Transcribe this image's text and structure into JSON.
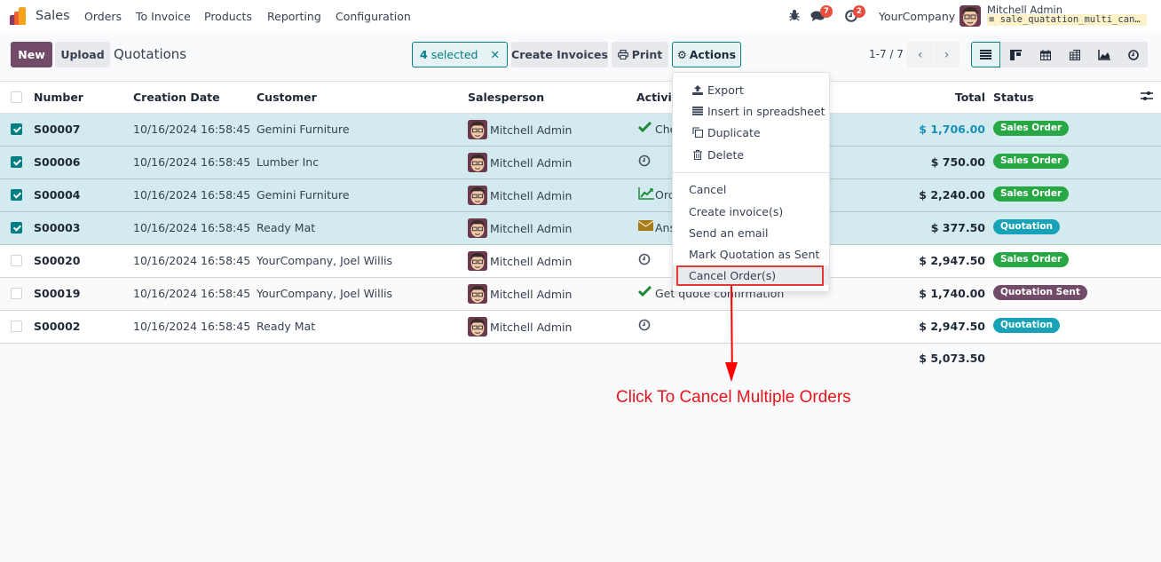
{
  "navbar": {
    "app_name": "Sales",
    "menu": [
      "Orders",
      "To Invoice",
      "Products",
      "Reporting",
      "Configuration"
    ],
    "icons": [
      "bug-icon",
      "chat-icon",
      "activity-clock-icon"
    ],
    "chat_count": "7",
    "activity_count": "2",
    "company": "YourCompany",
    "user_name": "Mitchell Admin",
    "database": "sale_quatation_multi_can…"
  },
  "control_panel": {
    "new_label": "New",
    "upload_label": "Upload",
    "title": "Quotations",
    "selected_count": "4",
    "selected_label": "selected",
    "create_invoices_label": "Create Invoices",
    "print_label": "Print",
    "actions_label": "Actions",
    "pager": "1-7 / 7",
    "views": [
      "list",
      "kanban",
      "calendar",
      "pivot",
      "graph",
      "activity"
    ]
  },
  "table": {
    "columns": [
      "Number",
      "Creation Date",
      "Customer",
      "Salesperson",
      "Activities",
      "Total",
      "Status"
    ],
    "rows": [
      {
        "selected": true,
        "number": "S00007",
        "date": "10/16/2024 16:58:45",
        "customer": "Gemini Furniture",
        "salesperson": "Mitchell Admin",
        "activity_icon": "check",
        "activity": "Che",
        "total": "$ 1,706.00",
        "status": "Sales Order",
        "status_color": "#28a745"
      },
      {
        "selected": true,
        "number": "S00006",
        "date": "10/16/2024 16:58:45",
        "customer": "Lumber Inc",
        "salesperson": "Mitchell Admin",
        "activity_icon": "clock",
        "activity": "",
        "total": "$ 750.00",
        "status": "Sales Order",
        "status_color": "#28a745"
      },
      {
        "selected": true,
        "number": "S00004",
        "date": "10/16/2024 16:58:45",
        "customer": "Gemini Furniture",
        "salesperson": "Mitchell Admin",
        "activity_icon": "chart",
        "activity": "Orc",
        "total": "$ 2,240.00",
        "status": "Sales Order",
        "status_color": "#28a745"
      },
      {
        "selected": true,
        "number": "S00003",
        "date": "10/16/2024 16:58:45",
        "customer": "Ready Mat",
        "salesperson": "Mitchell Admin",
        "activity_icon": "envelope",
        "activity": "Ans",
        "total": "$ 377.50",
        "status": "Quotation",
        "status_color": "#17a2b8"
      },
      {
        "selected": false,
        "number": "S00020",
        "date": "10/16/2024 16:58:45",
        "customer": "YourCompany, Joel Willis",
        "salesperson": "Mitchell Admin",
        "activity_icon": "clock",
        "activity": "",
        "total": "$ 2,947.50",
        "status": "Sales Order",
        "status_color": "#28a745"
      },
      {
        "selected": false,
        "number": "S00019",
        "date": "10/16/2024 16:58:45",
        "customer": "YourCompany, Joel Willis",
        "salesperson": "Mitchell Admin",
        "activity_icon": "check",
        "activity": "Get quote confirmation",
        "total": "$ 1,740.00",
        "status": "Quotation Sent",
        "status_color": "#714b67"
      },
      {
        "selected": false,
        "number": "S00002",
        "date": "10/16/2024 16:58:45",
        "customer": "Ready Mat",
        "salesperson": "Mitchell Admin",
        "activity_icon": "clock",
        "activity": "",
        "total": "$ 2,947.50",
        "status": "Quotation",
        "status_color": "#17a2b8"
      }
    ],
    "sum_total": "$ 5,073.50"
  },
  "actions_menu": {
    "section1": [
      {
        "icon": "upload-icon",
        "label": "Export"
      },
      {
        "icon": "spreadsheet-icon",
        "label": "Insert in spreadsheet"
      },
      {
        "icon": "duplicate-icon",
        "label": "Duplicate"
      },
      {
        "icon": "trash-icon",
        "label": "Delete"
      }
    ],
    "section2": [
      "Cancel",
      "Create invoice(s)",
      "Send an email",
      "Mark Quotation as Sent",
      "Cancel Order(s)"
    ]
  },
  "annotation": {
    "text": "Click To Cancel Multiple Orders",
    "color": "#e8141a"
  }
}
